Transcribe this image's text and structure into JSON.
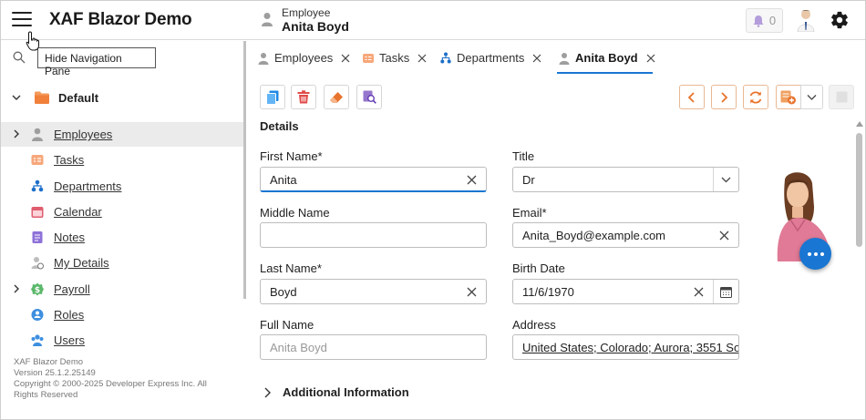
{
  "header": {
    "app_title": "XAF Blazor Demo",
    "caption": "Employee",
    "object_name": "Anita Boyd",
    "notification_count": "0"
  },
  "tooltip": {
    "text": "Hide Navigation Pane"
  },
  "sidebar": {
    "group_label": "Default",
    "items": [
      {
        "label": "Employees",
        "icon": "employee-icon",
        "expandable": true,
        "selected": true
      },
      {
        "label": "Tasks",
        "icon": "tasks-icon"
      },
      {
        "label": "Departments",
        "icon": "departments-icon"
      },
      {
        "label": "Calendar",
        "icon": "calendar-icon"
      },
      {
        "label": "Notes",
        "icon": "notes-icon"
      },
      {
        "label": "My Details",
        "icon": "my-details-icon"
      },
      {
        "label": "Payroll",
        "icon": "payroll-icon",
        "expandable": true
      },
      {
        "label": "Roles",
        "icon": "roles-icon"
      },
      {
        "label": "Users",
        "icon": "users-icon"
      }
    ],
    "footer": {
      "line1": "XAF Blazor Demo",
      "line2": "Version 25.1.2.25149",
      "line3": "Copyright © 2000-2025 Developer Express Inc. All Rights Reserved"
    }
  },
  "tabs": [
    {
      "label": "Employees",
      "icon": "employee-icon"
    },
    {
      "label": "Tasks",
      "icon": "tasks-icon"
    },
    {
      "label": "Departments",
      "icon": "departments-icon"
    },
    {
      "label": "Anita Boyd",
      "icon": "employee-icon",
      "active": true
    }
  ],
  "details": {
    "section_title": "Details",
    "first_name": {
      "label": "First Name*",
      "value": "Anita"
    },
    "middle_name": {
      "label": "Middle Name",
      "value": ""
    },
    "last_name": {
      "label": "Last Name*",
      "value": "Boyd"
    },
    "full_name": {
      "label": "Full Name",
      "value": "Anita Boyd"
    },
    "title": {
      "label": "Title",
      "value": "Dr"
    },
    "email": {
      "label": "Email*",
      "value": "Anita_Boyd@example.com"
    },
    "birth_date": {
      "label": "Birth Date",
      "value": "11/6/1970"
    },
    "address": {
      "label": "Address",
      "value": "United States; Colorado; Aurora; 3551 So..."
    },
    "additional_info": "Additional Information"
  },
  "colors": {
    "accent": "#1976d2",
    "delete": "#e04b4b",
    "nav_orange": "#e8732c",
    "selected_row": "#ebebeb"
  }
}
